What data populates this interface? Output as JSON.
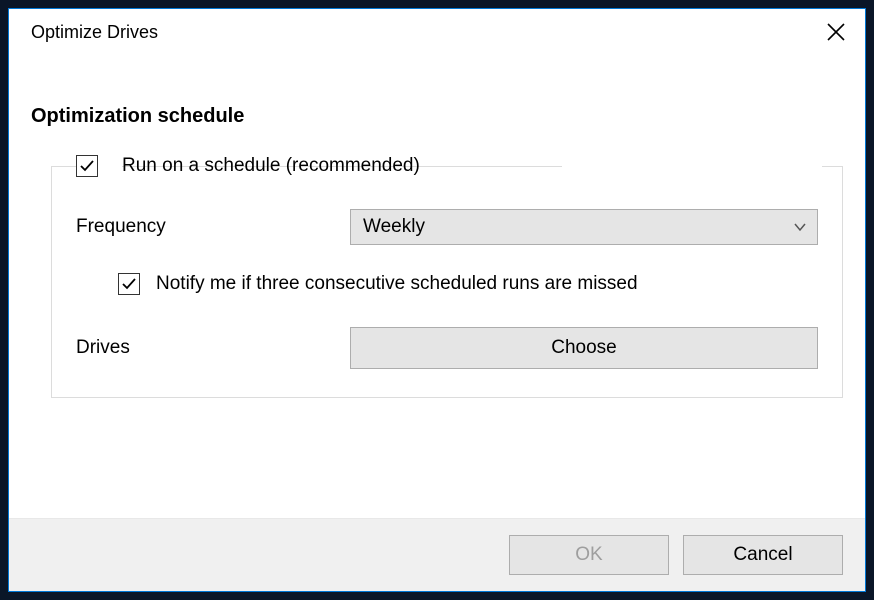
{
  "window": {
    "title": "Optimize Drives"
  },
  "section": {
    "heading": "Optimization schedule"
  },
  "schedule": {
    "run_label": "Run on a schedule (recommended)",
    "run_checked": true,
    "frequency_label": "Frequency",
    "frequency_value": "Weekly",
    "notify_label": "Notify me if three consecutive scheduled runs are missed",
    "notify_checked": true,
    "drives_label": "Drives",
    "choose_label": "Choose"
  },
  "footer": {
    "ok_label": "OK",
    "ok_enabled": false,
    "cancel_label": "Cancel"
  }
}
